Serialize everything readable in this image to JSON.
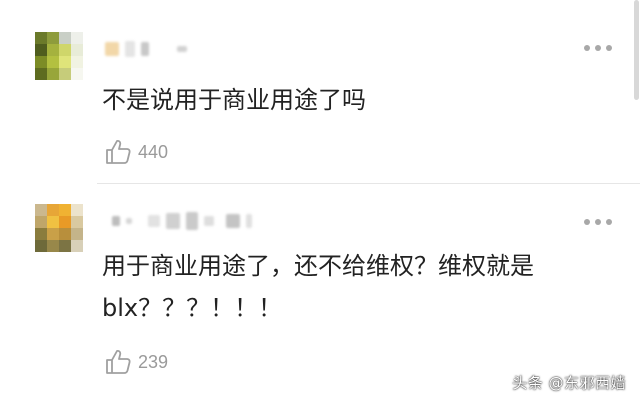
{
  "comments": [
    {
      "text": "不是说用于商业用途了吗",
      "likes": "440",
      "avatar_colors": [
        "#6b7a2a",
        "#8e9c3c",
        "#c9cfc6",
        "#eef0ea",
        "#4f5d1e",
        "#a5b23e",
        "#cfd66a",
        "#e8ecd8",
        "#7c8c26",
        "#b3c040",
        "#dfe47a",
        "#f1f3e2",
        "#5e6c20",
        "#98a63a",
        "#c6cc7a",
        "#f6f7f0"
      ]
    },
    {
      "text": "用于商业用途了，还不给维权？维权就是blx？？？！！！",
      "likes": "239",
      "avatar_colors": [
        "#cbb88e",
        "#e7a637",
        "#f0b232",
        "#ece3cc",
        "#bfa66a",
        "#f0c142",
        "#e89a26",
        "#d9c9a0",
        "#8a7c3d",
        "#c9a048",
        "#b88f3c",
        "#c4b48a",
        "#6e6a3a",
        "#98884a",
        "#7c7444",
        "#d8d0b8"
      ]
    }
  ],
  "watermark": "头条 @东邪西嫱",
  "icons": {
    "more": "more-dots-icon",
    "like": "thumbs-up-icon"
  },
  "colors": {
    "text": "#222222",
    "muted": "#9a9a9a",
    "divider": "#e6e6e6"
  }
}
